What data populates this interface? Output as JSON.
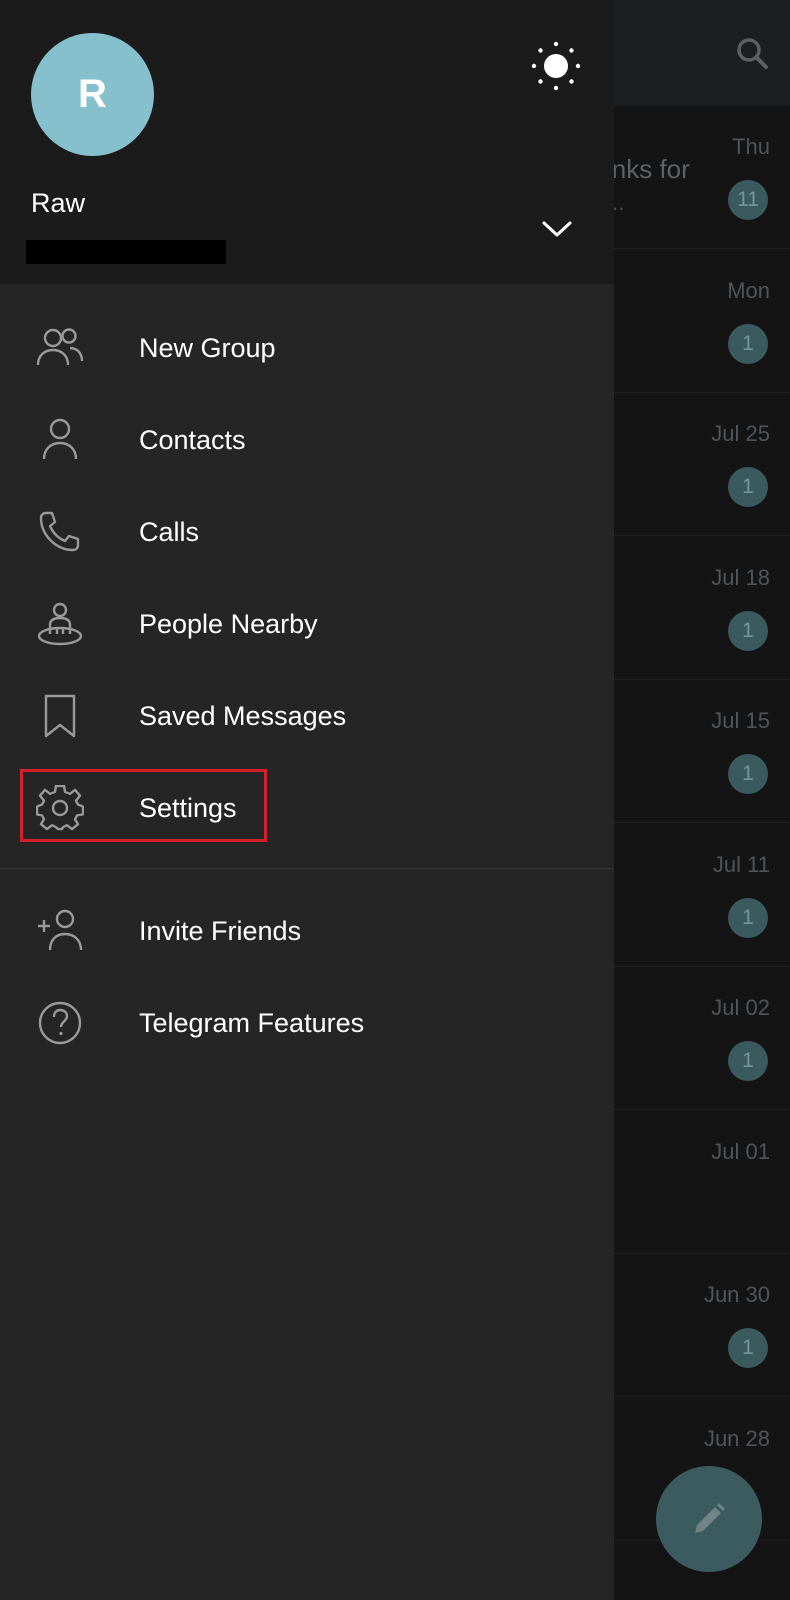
{
  "drawer": {
    "avatar_letter": "R",
    "user_name": "Raw",
    "menu_primary": [
      {
        "label": "New Group",
        "icon": "new-group-icon"
      },
      {
        "label": "Contacts",
        "icon": "contacts-icon"
      },
      {
        "label": "Calls",
        "icon": "calls-icon"
      },
      {
        "label": "People Nearby",
        "icon": "people-nearby-icon"
      },
      {
        "label": "Saved Messages",
        "icon": "saved-messages-icon"
      },
      {
        "label": "Settings",
        "icon": "settings-icon",
        "highlighted": true
      }
    ],
    "menu_secondary": [
      {
        "label": "Invite Friends",
        "icon": "invite-friends-icon"
      },
      {
        "label": "Telegram Features",
        "icon": "telegram-features-icon"
      }
    ]
  },
  "chat_list": {
    "rows": [
      {
        "date": "Thu",
        "badge": "11",
        "snippet": "inks for",
        "snippet2": "..."
      },
      {
        "date": "Mon",
        "badge": "1",
        "snippet": "",
        "snippet2": ""
      },
      {
        "date": "Jul 25",
        "badge": "1",
        "snippet": "",
        "snippet2": ""
      },
      {
        "date": "Jul 18",
        "badge": "1",
        "snippet": "",
        "snippet2": ""
      },
      {
        "date": "Jul 15",
        "badge": "1",
        "snippet": "!",
        "snippet2": ""
      },
      {
        "date": "Jul 11",
        "badge": "1",
        "snippet": "",
        "snippet2": ""
      },
      {
        "date": "Jul 02",
        "badge": "1",
        "snippet": "",
        "snippet2": ""
      },
      {
        "date": "Jul 01",
        "badge": "",
        "snippet": "",
        "snippet2": ""
      },
      {
        "date": "Jun 30",
        "badge": "1",
        "snippet": "",
        "snippet2": ""
      },
      {
        "date": "Jun 28",
        "badge": "",
        "snippet": "",
        "snippet2": ""
      }
    ]
  },
  "colors": {
    "avatar": "#86c0cc",
    "drawer_bg": "#252525",
    "header_bg": "#1b1b1b",
    "highlight_box": "#d3202a"
  }
}
